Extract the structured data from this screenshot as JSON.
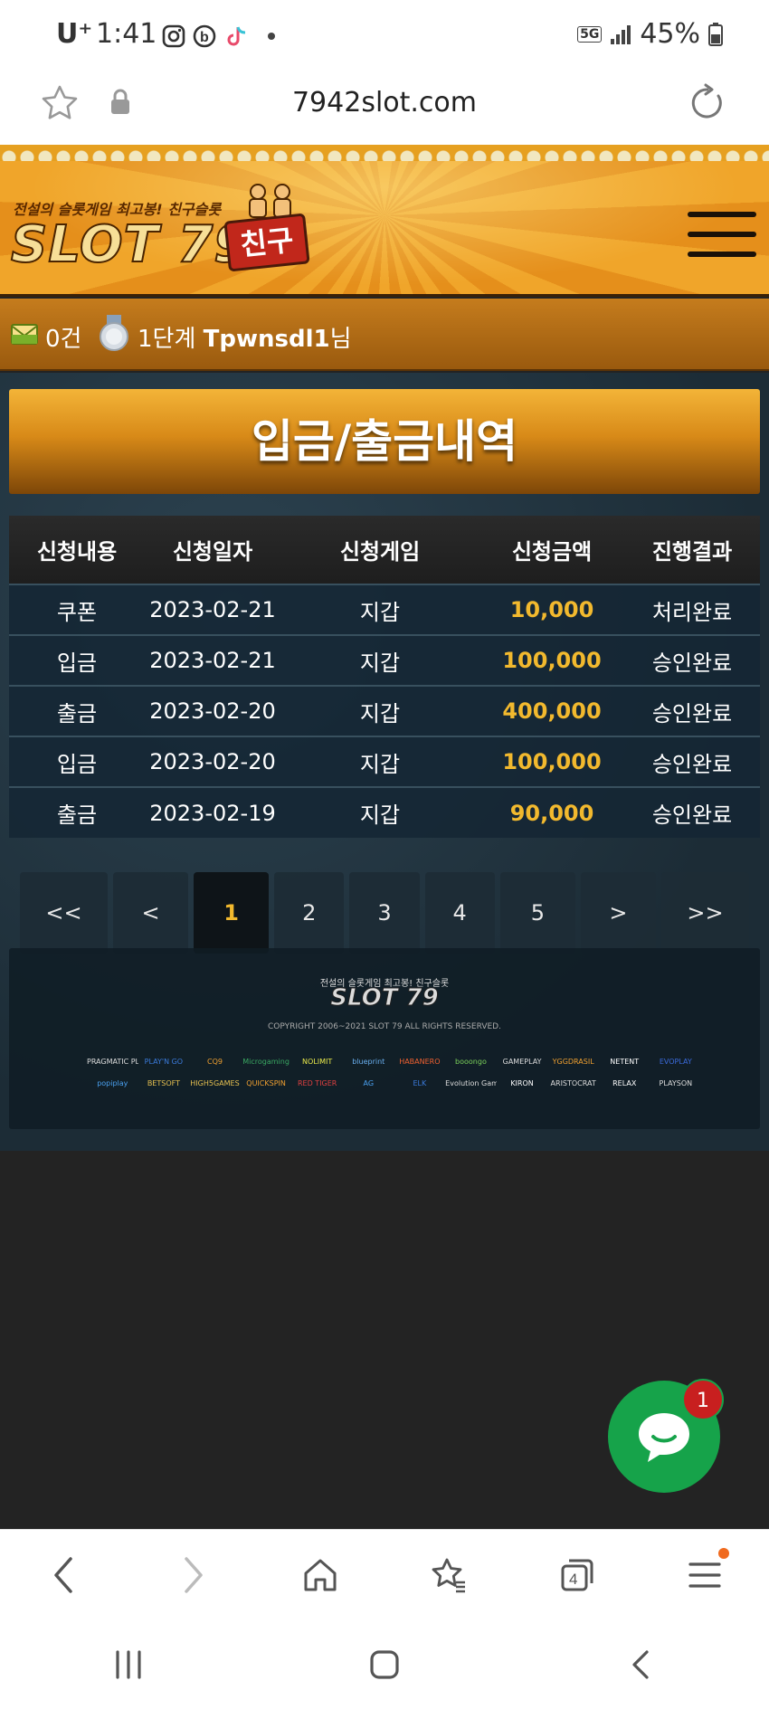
{
  "status_bar": {
    "carrier": "U⁺",
    "time": "1:41",
    "network": "5G",
    "battery": "45%",
    "icons": [
      "instagram-icon",
      "b-app-icon",
      "tiktok-icon",
      "dot-icon",
      "signal-icon",
      "battery-icon"
    ]
  },
  "browser": {
    "url": "7942slot.com"
  },
  "header": {
    "logo_tagline": "전설의 슬롯게임 최고봉! 친구슬롯",
    "logo_text": "SLOT 79",
    "logo_badge": "친구"
  },
  "user": {
    "messages": "0건",
    "level": "1단계",
    "username": "Tpwnsdl1",
    "suffix": "님"
  },
  "page": {
    "title": "입금/출금내역"
  },
  "table": {
    "headers": [
      "신청내용",
      "신청일자",
      "신청게임",
      "신청금액",
      "진행결과"
    ],
    "rows": [
      {
        "type": "쿠폰",
        "date": "2023-02-21",
        "game": "지갑",
        "amount": "10,000",
        "result": "처리완료"
      },
      {
        "type": "입금",
        "date": "2023-02-21",
        "game": "지갑",
        "amount": "100,000",
        "result": "승인완료"
      },
      {
        "type": "출금",
        "date": "2023-02-20",
        "game": "지갑",
        "amount": "400,000",
        "result": "승인완료"
      },
      {
        "type": "입금",
        "date": "2023-02-20",
        "game": "지갑",
        "amount": "100,000",
        "result": "승인완료"
      },
      {
        "type": "출금",
        "date": "2023-02-19",
        "game": "지갑",
        "amount": "90,000",
        "result": "승인완료"
      }
    ]
  },
  "pagination": {
    "first": "<<",
    "prev": "<",
    "pages": [
      "1",
      "2",
      "3",
      "4",
      "5"
    ],
    "current": "1",
    "next": ">",
    "last": ">>"
  },
  "footer": {
    "tagline": "전설의 슬롯게임 최고봉! 친구슬롯",
    "logo_text": "SLOT 79",
    "copyright": "COPYRIGHT 2006~2021 SLOT 79 ALL RIGHTS RESERVED.",
    "providers": [
      "PRAGMATIC PLAY",
      "PLAY'N GO",
      "CQ9",
      "Microgaming",
      "NOLIMIT",
      "blueprint",
      "HABANERO",
      "booongo",
      "GAMEPLAY",
      "YGGDRASIL",
      "NETENT",
      "EVOPLAY",
      "popiplay",
      "BETSOFT",
      "HIGH5GAMES",
      "QUICKSPIN",
      "RED TIGER",
      "AG",
      "ELK",
      "Evolution Gaming",
      "KIRON",
      "ARISTOCRAT",
      "RELAX",
      "PLAYSON"
    ]
  },
  "chat": {
    "badge_count": "1"
  },
  "colors": {
    "accent_gold": "#f2b92e",
    "header_orange": "#e58f1b",
    "chat_green": "#16a34a",
    "badge_red": "#c81f1f"
  }
}
